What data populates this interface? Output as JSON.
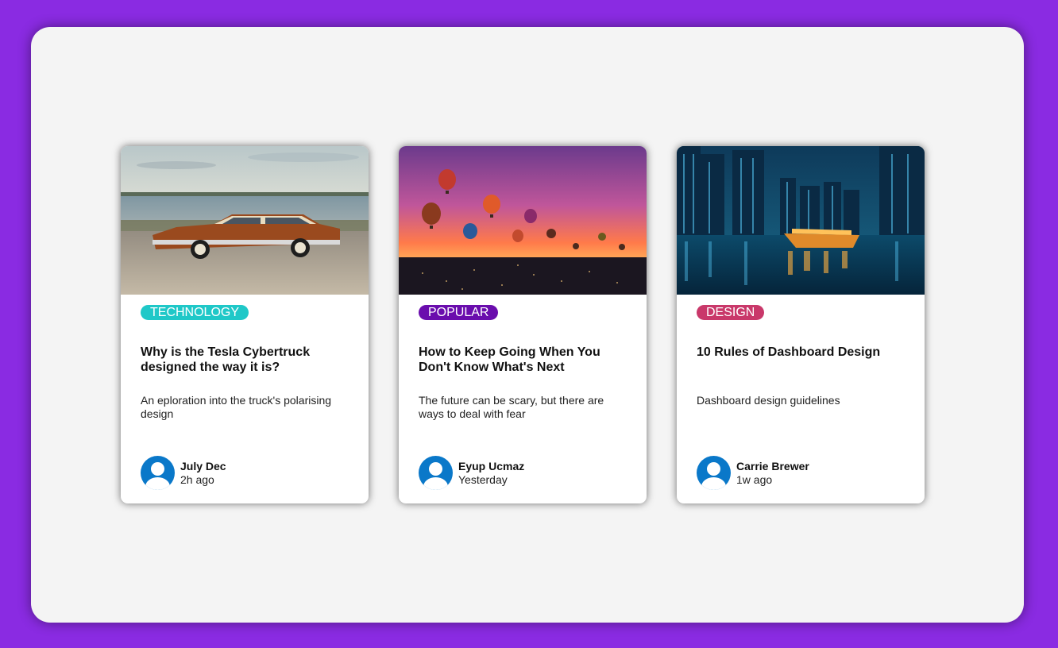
{
  "cards": [
    {
      "tag": "TECHNOLOGY",
      "tag_color": "#1fc8c8",
      "image": "vintage-car-photo",
      "title": "Why is the Tesla Cybertruck designed the way it is?",
      "description": "An eploration into the truck's polarising design",
      "author": "July Dec",
      "time": "2h ago"
    },
    {
      "tag": "POPULAR",
      "tag_color": "#6a0dad",
      "image": "hot-air-balloons-photo",
      "title": "How to Keep Going When You Don't Know What's Next",
      "description": "The future can be scary, but there are ways to deal with fear",
      "author": "Eyup Ucmaz",
      "time": "Yesterday"
    },
    {
      "tag": "DESIGN",
      "tag_color": "#c9386a",
      "image": "city-night-photo",
      "title": "10 Rules of Dashboard Design",
      "description": "Dashboard design guidelines",
      "author": "Carrie Brewer",
      "time": "1w ago"
    }
  ],
  "colors": {
    "background": "#8a2be2",
    "panel": "#f4f4f4",
    "avatar": "#0a78c9"
  }
}
